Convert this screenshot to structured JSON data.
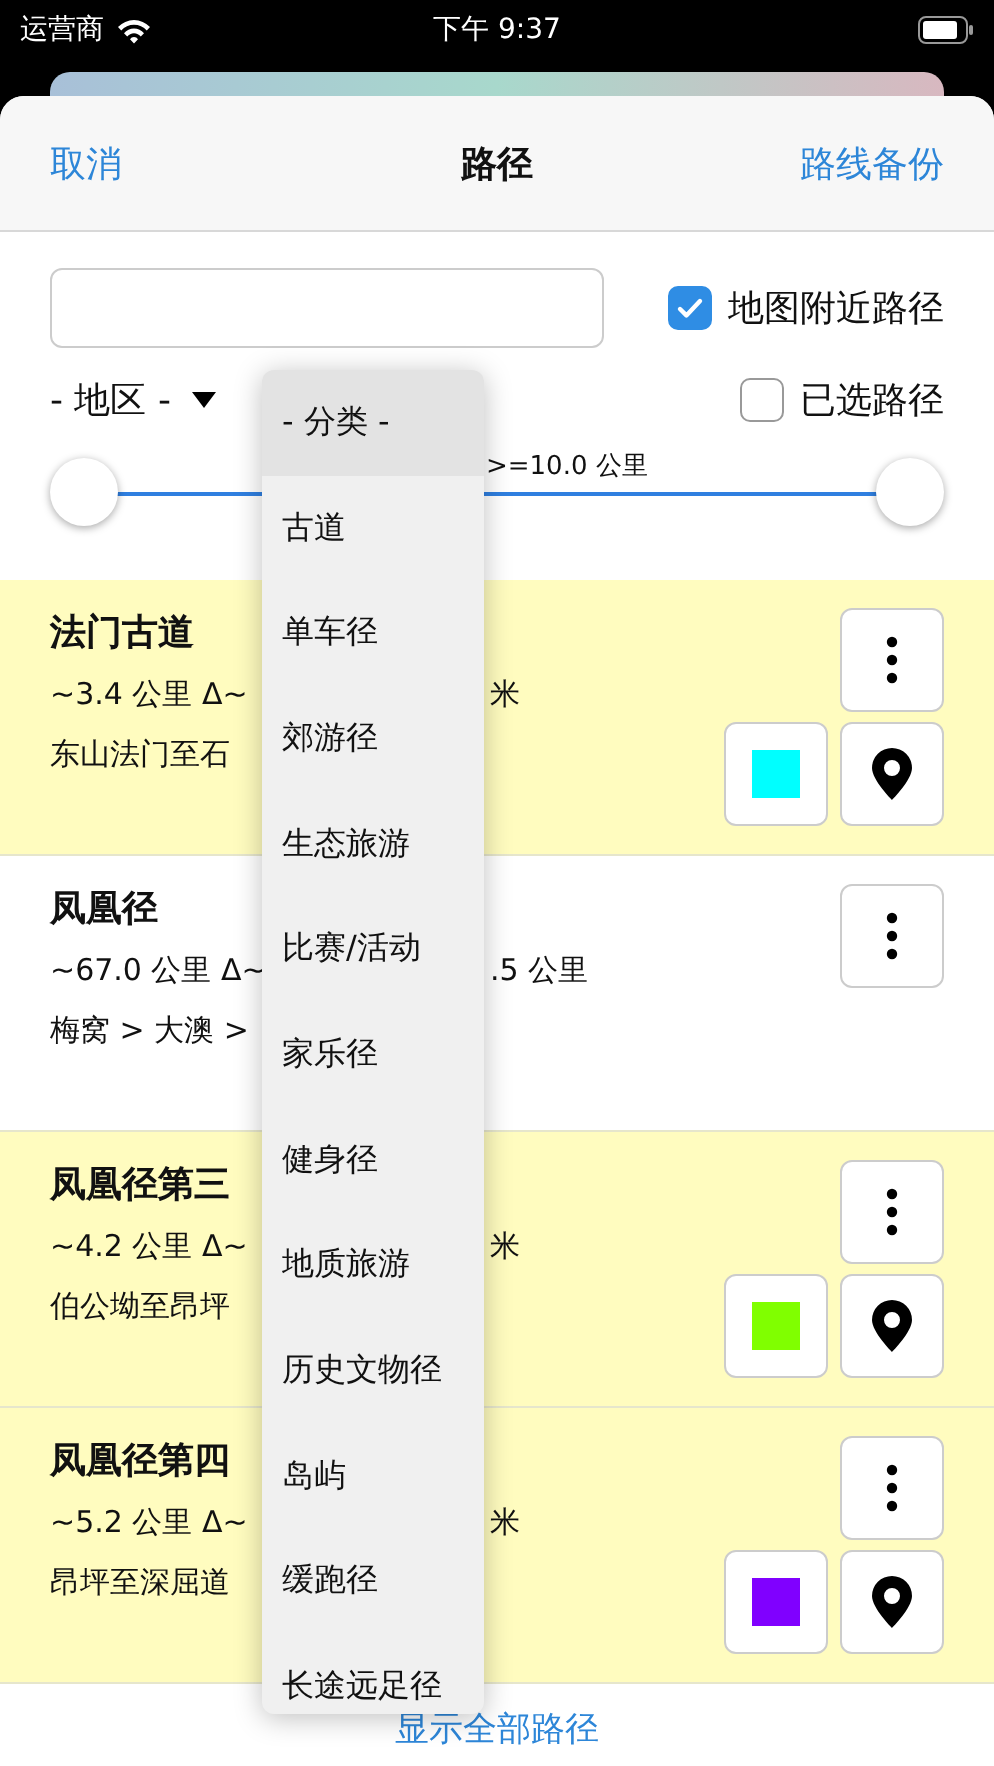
{
  "status_bar": {
    "carrier": "运营商",
    "time": "下午 9:37"
  },
  "header": {
    "cancel": "取消",
    "title": "路径",
    "backup": "路线备份"
  },
  "filters": {
    "nearby": {
      "label": "地图附近路径",
      "checked": true
    },
    "region": {
      "label": "- 地区 -"
    },
    "selected_only": {
      "label": "已选路径",
      "checked": false
    },
    "distance": {
      "label": ">=10.0 公里",
      "low": {
        "level": 0
      },
      "high": {
        "level": 1
      }
    }
  },
  "routes": [
    {
      "title": "法门古道",
      "stats": "~3.4 公里 Δ~",
      "stats_tail": "米",
      "route": "东山法门至石",
      "highlighted": true,
      "color": "#00ffff"
    },
    {
      "title": "凤凰径",
      "stats": "~67.0 公里 Δ~",
      "stats_tail": ".5 公里",
      "route": "梅窝 > 大澳 >",
      "highlighted": false
    },
    {
      "title": "凤凰径第三",
      "stats": "~4.2 公里 Δ~",
      "stats_tail": "米",
      "route": "伯公坳至昂坪",
      "highlighted": true,
      "color": "#80ff00"
    },
    {
      "title": "凤凰径第四",
      "stats": "~5.2 公里 Δ~",
      "stats_tail": "米",
      "route": "昂坪至深屈道",
      "highlighted": true,
      "color": "#8000ff"
    }
  ],
  "category_menu": {
    "options": [
      {
        "label": "- 分类 -",
        "selected": true
      },
      {
        "label": "古道",
        "selected": false
      },
      {
        "label": "单车径",
        "selected": false
      },
      {
        "label": "郊游径",
        "selected": false
      },
      {
        "label": "生态旅游",
        "selected": false
      },
      {
        "label": "比赛/活动",
        "selected": false
      },
      {
        "label": "家乐径",
        "selected": false
      },
      {
        "label": "健身径",
        "selected": false
      },
      {
        "label": "地质旅游",
        "selected": false
      },
      {
        "label": "历史文物径",
        "selected": false
      },
      {
        "label": "岛屿",
        "selected": false
      },
      {
        "label": "缓跑径",
        "selected": false
      },
      {
        "label": "长途远足径",
        "selected": false
      }
    ]
  },
  "footer": {
    "show_all": "显示全部路径"
  }
}
